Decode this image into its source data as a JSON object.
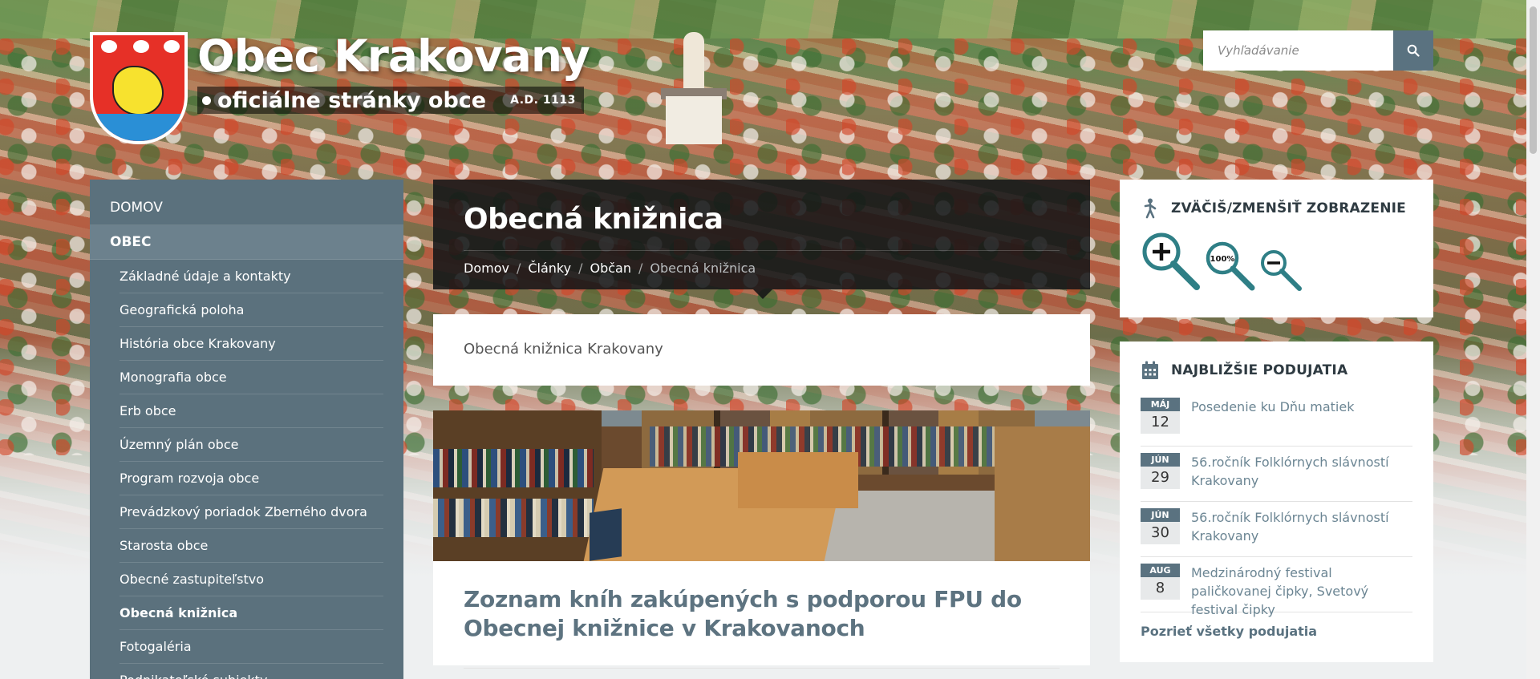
{
  "header": {
    "site_title": "Obec Krakovany",
    "site_subtitle": "oficiálne stránky obce",
    "site_ad": "A.D. 1113",
    "logo_icon": "coat-of-arms"
  },
  "search": {
    "placeholder": "Vyhľadávanie",
    "value": "",
    "icon": "search-icon"
  },
  "sidebar": {
    "top_items": [
      {
        "label": "DOMOV",
        "active": false
      },
      {
        "label": "OBEC",
        "active": true
      }
    ],
    "sub_items": [
      {
        "label": "Základné údaje a kontakty"
      },
      {
        "label": "Geografická poloha"
      },
      {
        "label": "História obce Krakovany"
      },
      {
        "label": "Monografia obce"
      },
      {
        "label": "Erb obce"
      },
      {
        "label": "Územný plán obce"
      },
      {
        "label": "Program rozvoja obce"
      },
      {
        "label": "Prevádzkový poriadok Zberného dvora"
      },
      {
        "label": "Starosta obce"
      },
      {
        "label": "Obecné zastupiteľstvo"
      },
      {
        "label": "Obecná knižnica",
        "current": true
      },
      {
        "label": "Fotogaléria"
      },
      {
        "label": "Podnikateľské subjekty"
      }
    ]
  },
  "main": {
    "page_title": "Obecná knižnica",
    "breadcrumb": [
      {
        "label": "Domov"
      },
      {
        "label": "Články"
      },
      {
        "label": "Občan"
      },
      {
        "label": "Obecná knižnica",
        "current": true
      }
    ],
    "breadcrumb_separator": "/",
    "intro_text": "Obecná knižnica Krakovany",
    "article_title": "Zoznam kníh zakúpených s podporou FPU do Obecnej knižnice v Krakovanoch"
  },
  "zoom_widget": {
    "title": "ZVÄČIŠ/ZMENŠIŤ ZOBRAZENIE",
    "icon": "accessibility-icon",
    "reset_label": "100%",
    "buttons": [
      "zoom-in-icon",
      "zoom-reset-icon",
      "zoom-out-icon"
    ]
  },
  "events_widget": {
    "title": "NAJBLIŽŠIE PODUJATIA",
    "icon": "calendar-icon",
    "events": [
      {
        "month": "MÁJ",
        "day": "12",
        "title": "Posedenie ku Dňu matiek"
      },
      {
        "month": "JÚN",
        "day": "29",
        "title": "56.ročník Folklórnych slávností Krakovany"
      },
      {
        "month": "JÚN",
        "day": "30",
        "title": "56.ročník Folklórnych slávností Krakovany"
      },
      {
        "month": "AUG",
        "day": "8",
        "title": "Medzinárodný festival paličkovanej čipky, Svetový festival čipky"
      }
    ],
    "all_link": "Pozrieť všetky podujatia"
  },
  "colors": {
    "accent": "#5a7280",
    "sidebar_bg": "#5b717d",
    "title_bar_bg": "#121416",
    "link": "#6b8593",
    "zoom_icon": "#2f7f86"
  }
}
